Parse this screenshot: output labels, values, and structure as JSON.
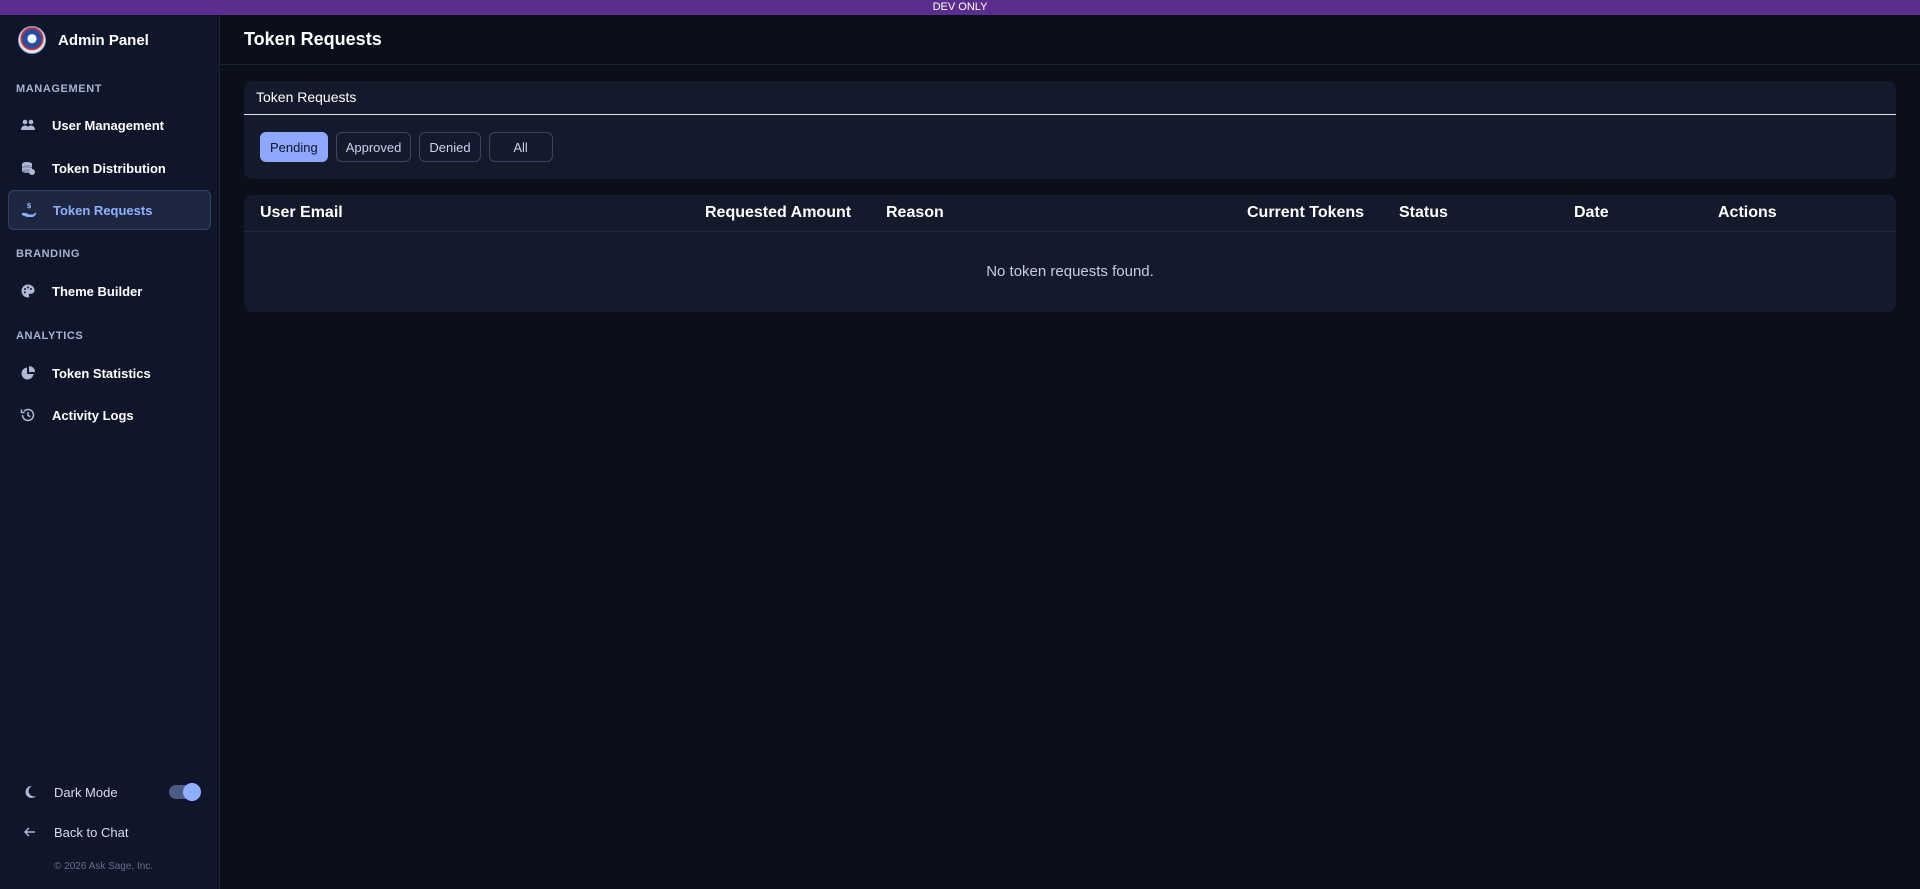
{
  "banner": {
    "text": "DEV ONLY"
  },
  "sidebar": {
    "title": "Admin Panel",
    "sections": {
      "management": "MANAGEMENT",
      "branding": "BRANDING",
      "analytics": "ANALYTICS"
    },
    "items": {
      "user_management": {
        "label": "User Management",
        "icon": "users-icon"
      },
      "token_distribution": {
        "label": "Token Distribution",
        "icon": "coins-icon"
      },
      "token_requests": {
        "label": "Token Requests",
        "icon": "hand-coin-icon"
      },
      "theme_builder": {
        "label": "Theme Builder",
        "icon": "palette-icon"
      },
      "token_statistics": {
        "label": "Token Statistics",
        "icon": "pie-chart-icon"
      },
      "activity_logs": {
        "label": "Activity Logs",
        "icon": "history-icon"
      }
    },
    "active_item": "Token Requests",
    "dark_mode": {
      "label": "Dark Mode",
      "enabled": true
    },
    "back_to_chat": "Back to Chat",
    "copyright": "© 2026 Ask Sage, Inc."
  },
  "header": {
    "title": "Token Requests"
  },
  "filter_card": {
    "title": "Token Requests",
    "filters": [
      "Pending",
      "Approved",
      "Denied",
      "All"
    ],
    "active_filter": "Pending"
  },
  "table": {
    "columns": [
      "User Email",
      "Requested Amount",
      "Reason",
      "Current Tokens",
      "Status",
      "Date",
      "Actions"
    ],
    "empty_message": "No token requests found."
  },
  "colors": {
    "accent": "#8fa8ff",
    "banner": "#5b2d8e",
    "background": "#0b0f19",
    "sidebar": "#10162a",
    "card": "#141a2c"
  }
}
